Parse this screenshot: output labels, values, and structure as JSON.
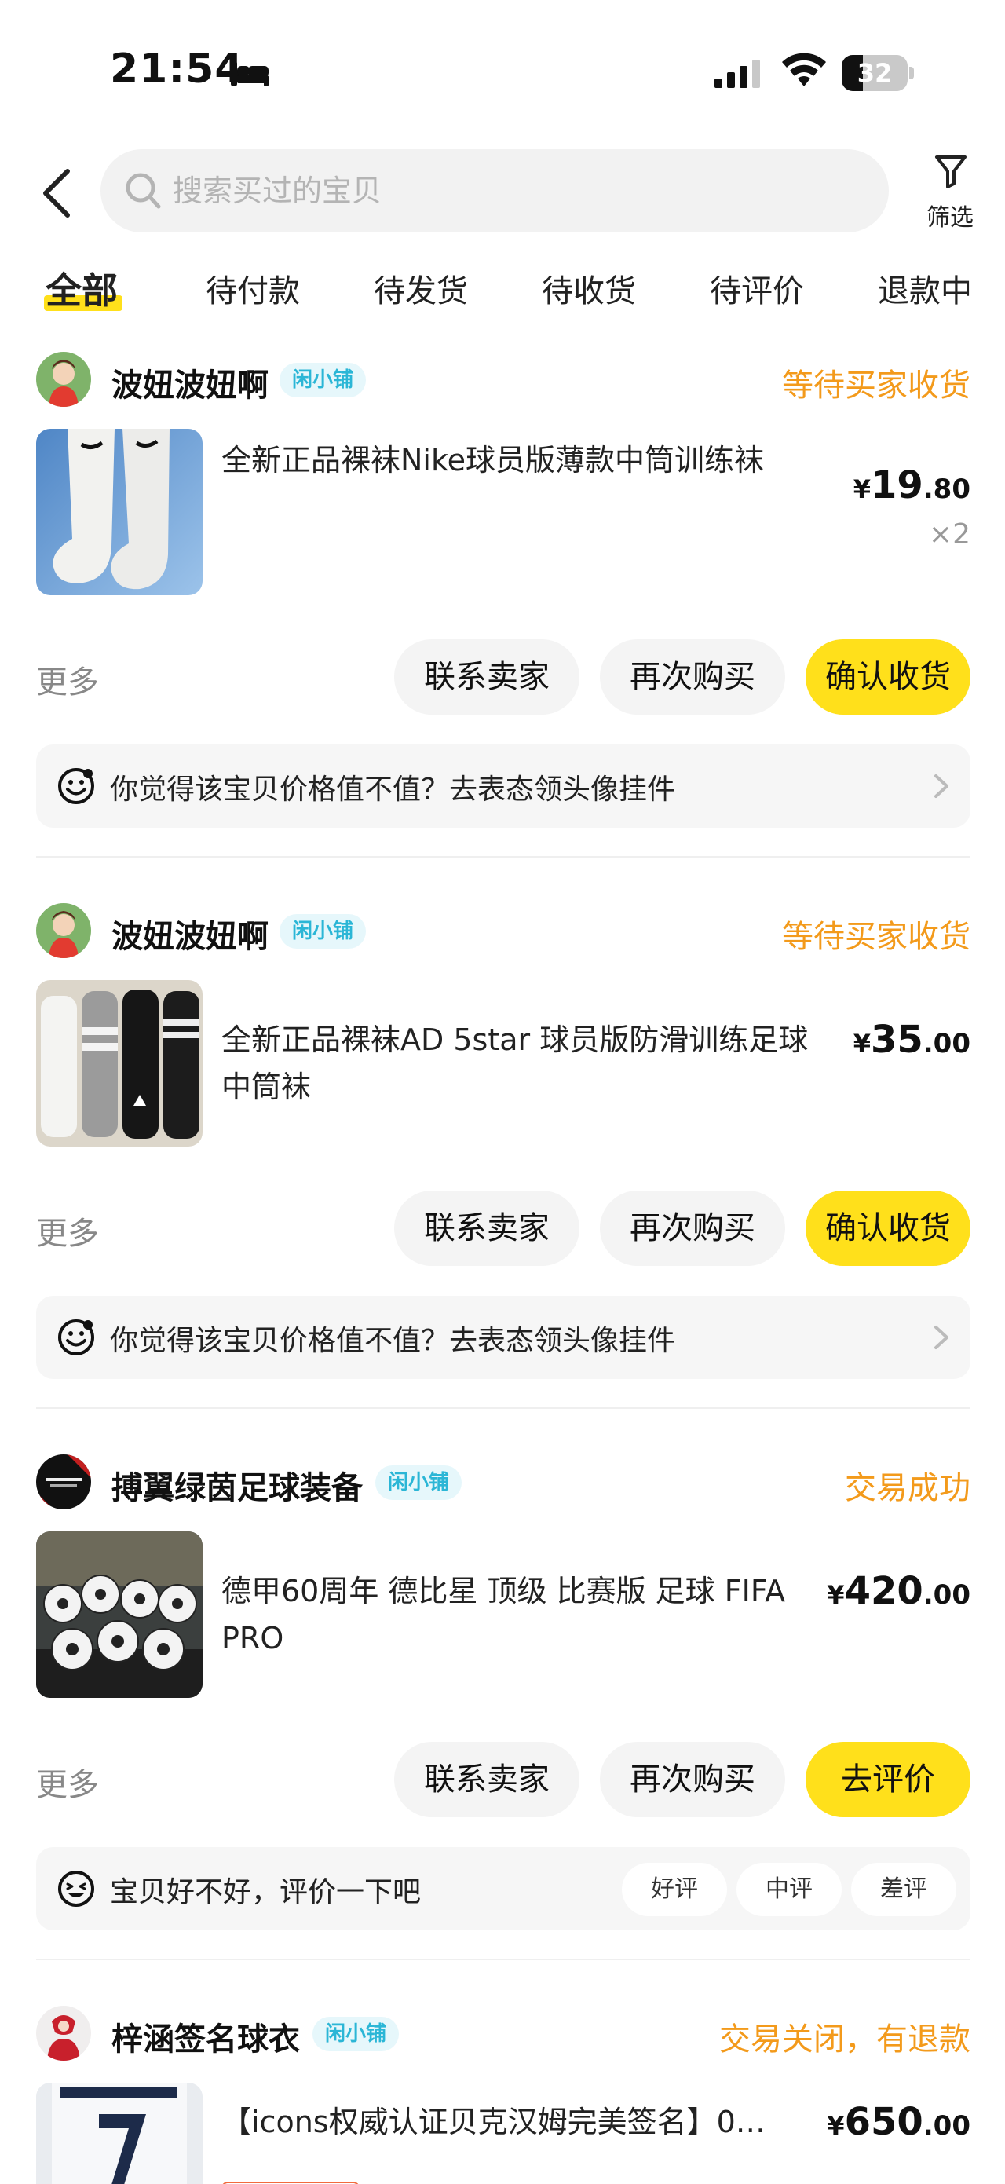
{
  "status_bar": {
    "time": "21:54",
    "battery_level": "32",
    "battery_fraction": 0.32
  },
  "header": {
    "search_placeholder": "搜索买过的宝贝",
    "filter_label": "筛选"
  },
  "tabs": [
    {
      "label": "全部",
      "active": true
    },
    {
      "label": "待付款",
      "active": false
    },
    {
      "label": "待发货",
      "active": false
    },
    {
      "label": "待收货",
      "active": false
    },
    {
      "label": "待评价",
      "active": false
    },
    {
      "label": "退款中",
      "active": false
    }
  ],
  "orders": [
    {
      "shop_name": "波妞波妞啊",
      "shop_badge": "闲小铺",
      "status": "等待买家收货",
      "product_title": "全新正品裸袜Nike球员版薄款中筒训练袜",
      "price_symbol": "¥",
      "price_int": "19",
      "price_dec": ".80",
      "quantity": "×2",
      "more_label": "更多",
      "buttons": [
        "联系卖家",
        "再次购买",
        "确认收货"
      ],
      "feedback_text": "你觉得该宝贝价格值不值？去表态领头像挂件"
    },
    {
      "shop_name": "波妞波妞啊",
      "shop_badge": "闲小铺",
      "status": "等待买家收货",
      "product_title": "全新正品裸袜AD 5star 球员版防滑训练足球中筒袜",
      "price_symbol": "¥",
      "price_int": "35",
      "price_dec": ".00",
      "more_label": "更多",
      "buttons": [
        "联系卖家",
        "再次购买",
        "确认收货"
      ],
      "feedback_text": "你觉得该宝贝价格值不值？去表态领头像挂件"
    },
    {
      "shop_name": "搏翼绿茵足球装备",
      "shop_badge": "闲小铺",
      "status": "交易成功",
      "product_title": "德甲60周年 德比星 顶级 比赛版 足球 FIFA PRO",
      "price_symbol": "¥",
      "price_int": "420",
      "price_dec": ".00",
      "more_label": "更多",
      "buttons": [
        "联系卖家",
        "再次购买",
        "去评价"
      ],
      "feedback_text": "宝贝好不好，评价一下吧",
      "rating_options": [
        "好评",
        "中评",
        "差评"
      ]
    },
    {
      "shop_name": "梓涵签名球衣",
      "shop_badge": "闲小铺",
      "status": "交易关闭，有退款",
      "product_title": "【icons权威认证贝克汉姆完美签名】0…",
      "price_symbol": "¥",
      "price_int": "650",
      "price_dec": ".00"
    }
  ],
  "colors": {
    "accent_yellow": "#ffe01b",
    "status_orange": "#f39a1b",
    "badge_cyan": "#2bb6d6"
  }
}
